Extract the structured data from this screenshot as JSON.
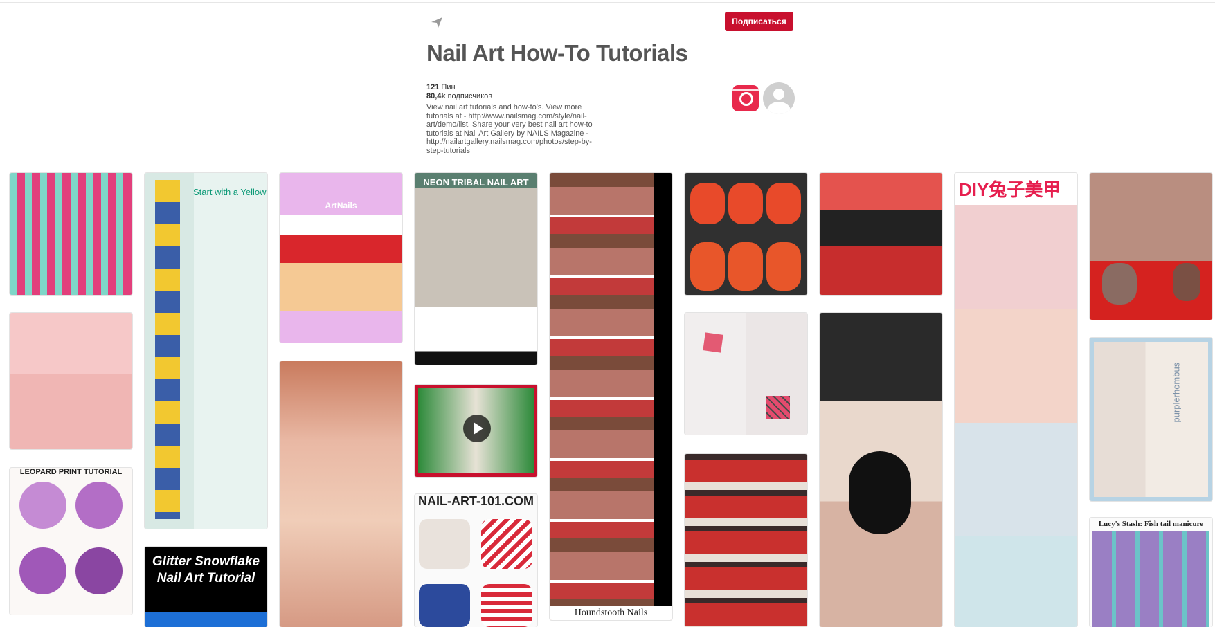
{
  "header": {
    "send_icon": "send-icon",
    "subscribe_label": "Подписаться",
    "subscribe_color": "#c8102e"
  },
  "board": {
    "title": "Nail Art How-To Tutorials",
    "pins_count": "121",
    "pins_label": "Пин",
    "followers_count": "80,4k",
    "followers_label": "подписчиков",
    "description": "View nail art tutorials and how-to's. View more tutorials at - http://www.nailsmag.com/style/nail-art/demo/list. Share your very best nail art how-to tutorials at Nail Art Gallery by NAILS Magazine - http://nailartgallery.nailsmag.com/photos/step-by-step-tutorials"
  },
  "pins": [
    {
      "caption": ""
    },
    {
      "caption": ""
    },
    {
      "caption": "LEOPARD PRINT TUTORIAL"
    },
    {
      "caption": "Start with a Yellow base"
    },
    {
      "caption": "Glitter Snowflake Nail Art Tutorial"
    },
    {
      "caption": "ArtNails"
    },
    {
      "caption": ""
    },
    {
      "caption": "NEON TRIBAL NAIL ART"
    },
    {
      "caption": ""
    },
    {
      "caption": "NAIL-ART-101.COM"
    },
    {
      "caption": "Houndstooth Nails"
    },
    {
      "caption": ""
    },
    {
      "caption": ""
    },
    {
      "caption": ""
    },
    {
      "caption": ""
    },
    {
      "caption": ""
    },
    {
      "caption": "DIY兔子美甲"
    },
    {
      "caption": ""
    },
    {
      "caption": "purplerhombus"
    },
    {
      "caption": "Lucy's Stash: Fish tail manicure"
    }
  ],
  "colors": {
    "title": "#555555",
    "accent_red": "#c8102e"
  }
}
